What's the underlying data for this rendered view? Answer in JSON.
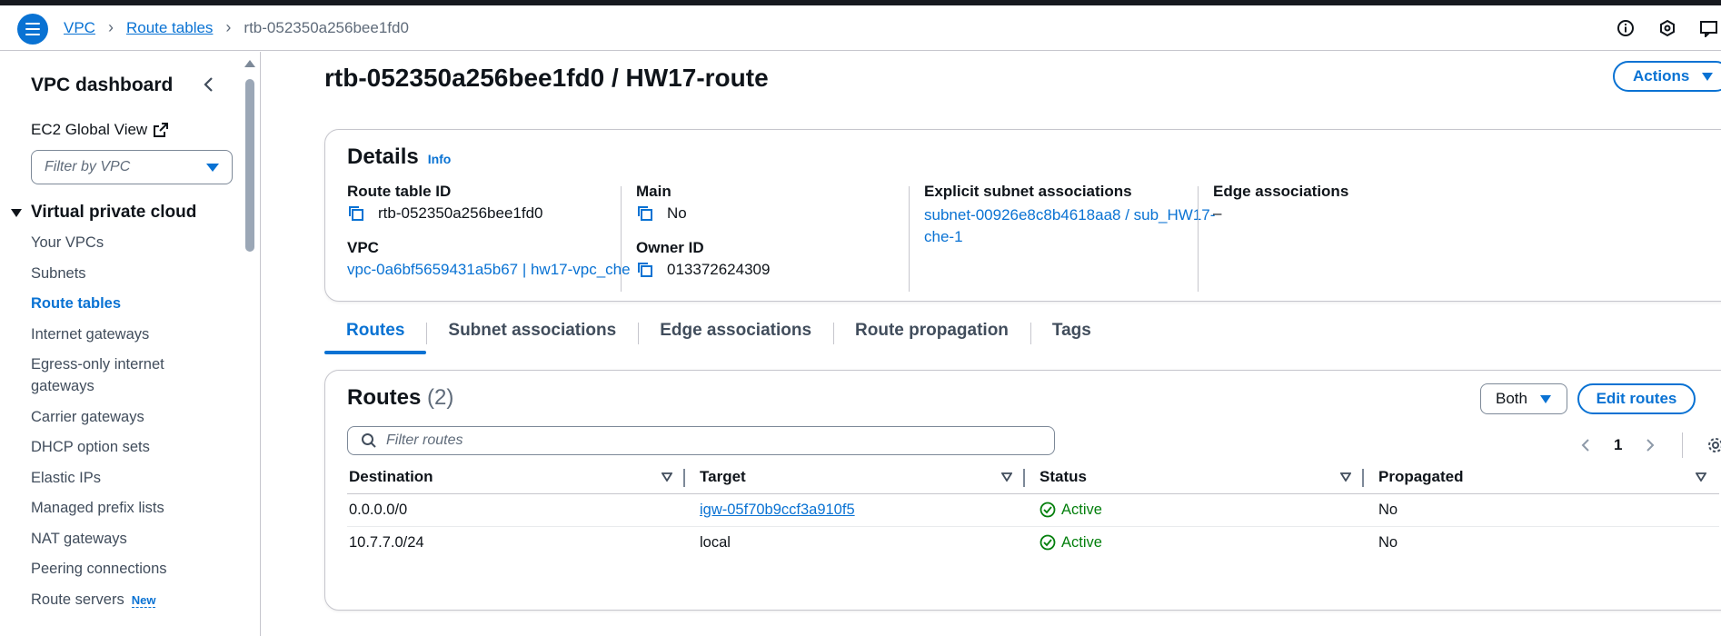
{
  "breadcrumbs": [
    "VPC",
    "Route tables",
    "rtb-052350a256bee1fd0"
  ],
  "sidebar": {
    "title": "VPC dashboard",
    "ec2_global_view": "EC2 Global View",
    "filter_placeholder": "Filter by VPC",
    "section": "Virtual private cloud",
    "items": [
      {
        "label": "Your VPCs"
      },
      {
        "label": "Subnets"
      },
      {
        "label": "Route tables",
        "active": true
      },
      {
        "label": "Internet gateways"
      },
      {
        "label": "Egress-only internet gateways"
      },
      {
        "label": "Carrier gateways"
      },
      {
        "label": "DHCP option sets"
      },
      {
        "label": "Elastic IPs"
      },
      {
        "label": "Managed prefix lists"
      },
      {
        "label": "NAT gateways"
      },
      {
        "label": "Peering connections"
      },
      {
        "label": "Route servers",
        "badge": "New"
      }
    ]
  },
  "page": {
    "title": "rtb-052350a256bee1fd0 / HW17-route",
    "actions_label": "Actions"
  },
  "details": {
    "heading": "Details",
    "info": "Info",
    "route_table_id_label": "Route table ID",
    "route_table_id": "rtb-052350a256bee1fd0",
    "vpc_label": "VPC",
    "vpc": "vpc-0a6bf5659431a5b67 | hw17-vpc_che",
    "main_label": "Main",
    "main": "No",
    "owner_id_label": "Owner ID",
    "owner_id": "013372624309",
    "explicit_subnet_label": "Explicit subnet associations",
    "explicit_subnet_line1": "subnet-00926e8c8b4618aa8 / sub_HW17-",
    "explicit_subnet_line2": "che-1",
    "edge_label": "Edge associations",
    "edge": "–"
  },
  "tabs": [
    "Routes",
    "Subnet associations",
    "Edge associations",
    "Route propagation",
    "Tags"
  ],
  "routes": {
    "heading": "Routes",
    "count": "(2)",
    "filter_select": "Both",
    "edit_label": "Edit routes",
    "search_placeholder": "Filter routes",
    "page": "1",
    "columns": [
      "Destination",
      "Target",
      "Status",
      "Propagated"
    ],
    "rows": [
      {
        "destination": "0.0.0.0/0",
        "target": "igw-05f70b9ccf3a910f5",
        "target_link": true,
        "status": "Active",
        "propagated": "No"
      },
      {
        "destination": "10.7.7.0/24",
        "target": "local",
        "target_link": false,
        "status": "Active",
        "propagated": "No"
      }
    ]
  },
  "colors": {
    "accent": "#0972d3",
    "success": "#037f0c",
    "text": "#0f141a"
  }
}
